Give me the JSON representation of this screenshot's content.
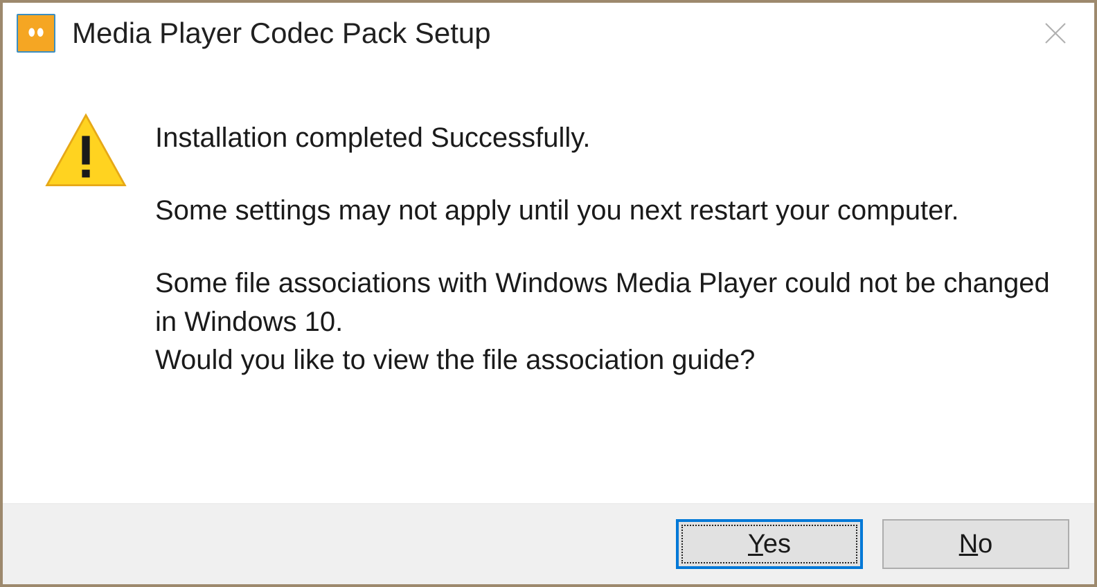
{
  "titlebar": {
    "title": "Media Player Codec Pack Setup"
  },
  "message": {
    "line1": "Installation completed Successfully.",
    "line2": "Some settings may not apply until you next restart your computer.",
    "line3": "Some file associations with Windows Media Player could not be changed in Windows 10.",
    "line4": "Would you like to view the file association guide?"
  },
  "buttons": {
    "yes_accel": "Y",
    "yes_rest": "es",
    "no_accel": "N",
    "no_rest": "o"
  }
}
